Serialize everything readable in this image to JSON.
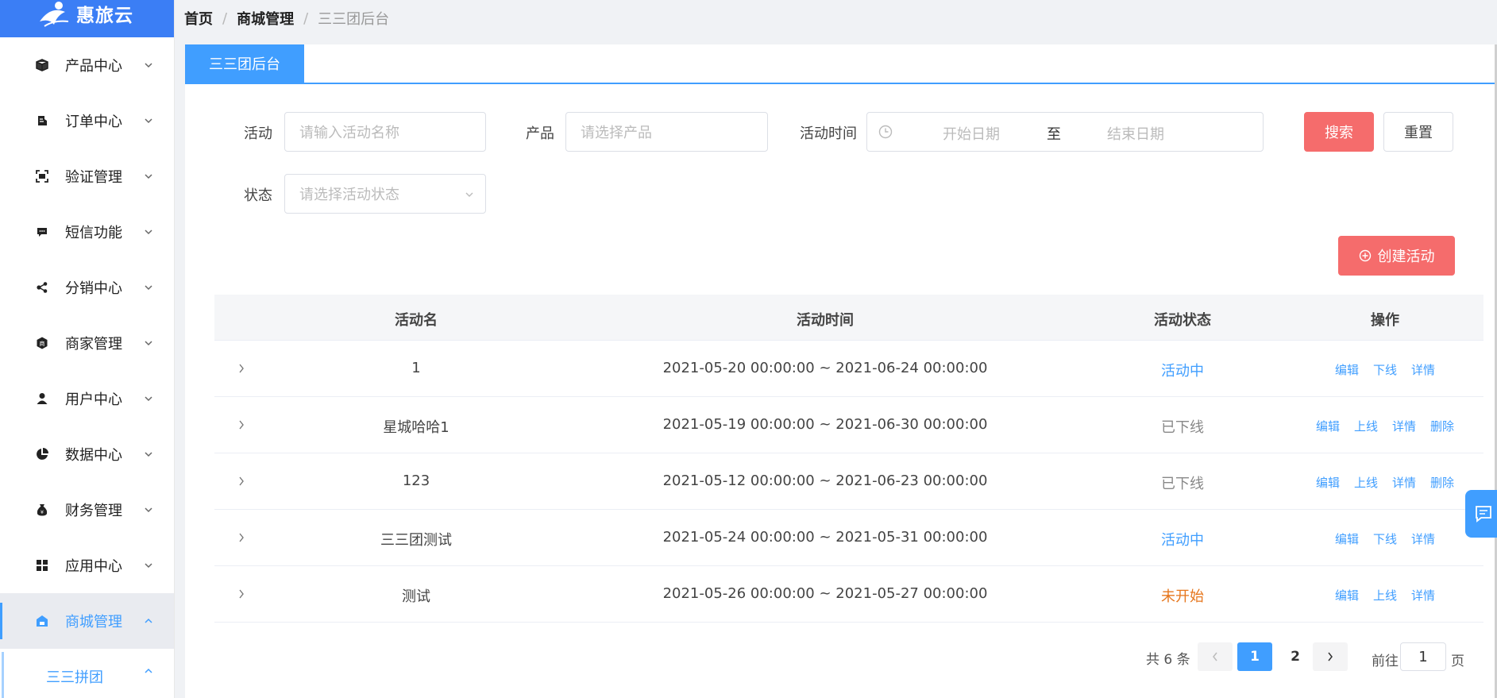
{
  "brand": {
    "name": "惠旅云",
    "color": "#3b7ef5"
  },
  "sidebar": {
    "items": [
      {
        "label": "产品中心",
        "icon": "box-icon"
      },
      {
        "label": "订单中心",
        "icon": "order-icon"
      },
      {
        "label": "验证管理",
        "icon": "scan-icon"
      },
      {
        "label": "短信功能",
        "icon": "message-icon"
      },
      {
        "label": "分销中心",
        "icon": "share-icon"
      },
      {
        "label": "商家管理",
        "icon": "merchant-icon"
      },
      {
        "label": "用户中心",
        "icon": "user-icon"
      },
      {
        "label": "数据中心",
        "icon": "pie-chart-icon"
      },
      {
        "label": "财务管理",
        "icon": "money-bag-icon"
      },
      {
        "label": "应用中心",
        "icon": "apps-icon"
      },
      {
        "label": "商城管理",
        "icon": "store-icon",
        "active": true
      }
    ],
    "sub_item": "三三拼团"
  },
  "breadcrumb": {
    "home": "首页",
    "section": "商城管理",
    "current": "三三团后台",
    "sep": "/"
  },
  "tab": {
    "label": "三三团后台"
  },
  "filters": {
    "activity_label": "活动",
    "activity_placeholder": "请输入活动名称",
    "product_label": "产品",
    "product_placeholder": "请选择产品",
    "time_label": "活动时间",
    "start_placeholder": "开始日期",
    "to": "至",
    "end_placeholder": "结束日期",
    "status_label": "状态",
    "status_placeholder": "请选择活动状态",
    "search": "搜索",
    "reset": "重置"
  },
  "create_button": "创建活动",
  "table": {
    "headers": [
      "活动名",
      "活动时间",
      "活动状态",
      "操作"
    ],
    "rows": [
      {
        "name": "1",
        "time": "2021-05-20 00:00:00 ~ 2021-06-24 00:00:00",
        "status": "活动中",
        "status_type": "blue",
        "ops": [
          "编辑",
          "下线",
          "详情"
        ]
      },
      {
        "name": "星城哈哈1",
        "time": "2021-05-19 00:00:00 ~ 2021-06-30 00:00:00",
        "status": "已下线",
        "status_type": "gray",
        "ops": [
          "编辑",
          "上线",
          "详情",
          "删除"
        ]
      },
      {
        "name": "123",
        "time": "2021-05-12 00:00:00 ~ 2021-06-23 00:00:00",
        "status": "已下线",
        "status_type": "gray",
        "ops": [
          "编辑",
          "上线",
          "详情",
          "删除"
        ]
      },
      {
        "name": "三三团测试",
        "time": "2021-05-24 00:00:00 ~ 2021-05-31 00:00:00",
        "status": "活动中",
        "status_type": "blue",
        "ops": [
          "编辑",
          "下线",
          "详情"
        ]
      },
      {
        "name": "测试",
        "time": "2021-05-26 00:00:00 ~ 2021-05-27 00:00:00",
        "status": "未开始",
        "status_type": "orange",
        "ops": [
          "编辑",
          "上线",
          "详情"
        ]
      }
    ]
  },
  "pagination": {
    "total": "共 6 条",
    "pages": [
      "1",
      "2"
    ],
    "current": "1",
    "goto_label": "前往",
    "goto_value": "1",
    "page_unit": "页"
  },
  "colors": {
    "primary": "#409eff",
    "danger": "#f56c6c",
    "warning": "#e6761c"
  }
}
